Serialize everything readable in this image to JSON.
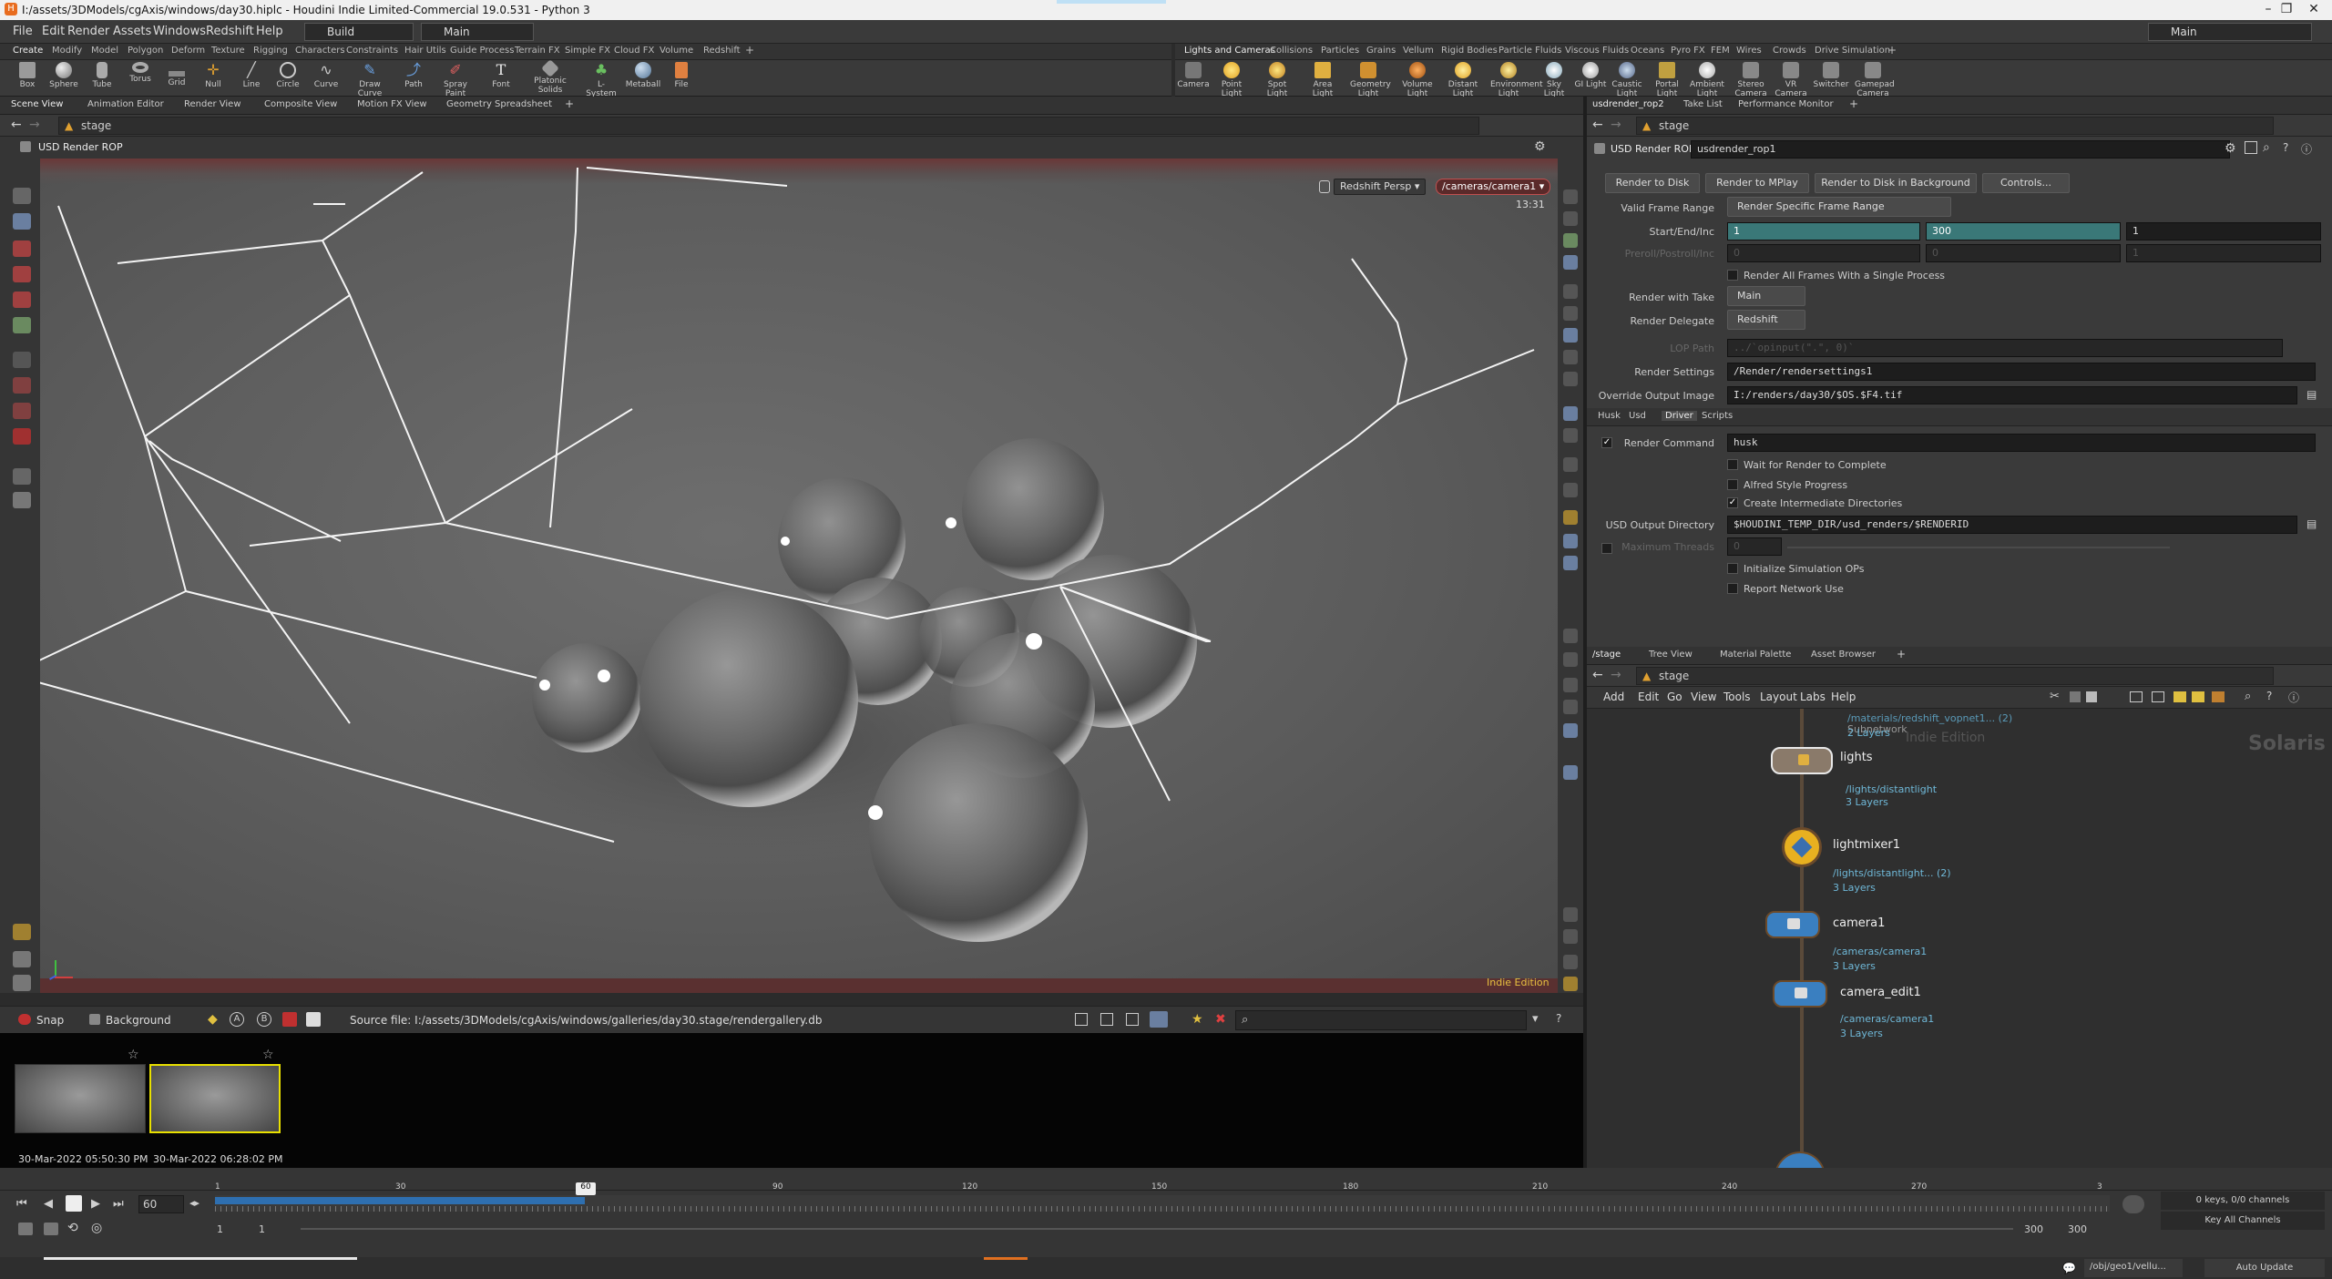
{
  "window": {
    "title": "I:/assets/3DModels/cgAxis/windows/day30.hiplc - Houdini Indie Limited-Commercial 19.0.531 - Python 3",
    "logo": "H",
    "controls": [
      "–",
      "❐",
      "✕"
    ]
  },
  "menu": {
    "items": [
      "File",
      "Edit",
      "Render",
      "Assets",
      "Windows",
      "Redshift",
      "Help"
    ],
    "desktop": "Build",
    "context": "Main",
    "right_context": "Main"
  },
  "shelf_left": {
    "tabs": [
      "Create",
      "Modify",
      "Model",
      "Polygon",
      "Deform",
      "Texture",
      "Rigging",
      "Characters",
      "Constraints",
      "Hair Utils",
      "Guide Process",
      "Terrain FX",
      "Simple FX",
      "Cloud FX",
      "Volume",
      "Redshift",
      "+"
    ],
    "tools": [
      "Box",
      "Sphere",
      "Tube",
      "Torus",
      "Grid",
      "Null",
      "Line",
      "Circle",
      "Curve",
      "Draw Curve",
      "Path",
      "Spray Paint",
      "Font",
      "Platonic Solids",
      "L-System",
      "Metaball",
      "File"
    ]
  },
  "shelf_right": {
    "tabs": [
      "Lights and Cameras",
      "Collisions",
      "Particles",
      "Grains",
      "Vellum",
      "Rigid Bodies",
      "Particle Fluids",
      "Viscous Fluids",
      "Oceans",
      "Pyro FX",
      "FEM",
      "Wires",
      "Crowds",
      "Drive Simulation",
      "+"
    ],
    "tools": [
      "Camera",
      "Point Light",
      "Spot Light",
      "Area Light",
      "Geometry Light",
      "Volume Light",
      "Distant Light",
      "Environment Light",
      "Sky Light",
      "GI Light",
      "Caustic Light",
      "Portal Light",
      "Ambient Light",
      "Stereo Camera",
      "VR Camera",
      "Switcher",
      "Gamepad Camera"
    ]
  },
  "left_pane": {
    "tabs": [
      "Scene View",
      "Animation Editor",
      "Render View",
      "Composite View",
      "Motion FX View",
      "Geometry Spreadsheet",
      "+"
    ],
    "path": "stage",
    "viewer_title": "USD Render ROP",
    "viewport": {
      "renderer": "Redshift  Persp ▾",
      "camera": "/cameras/camera1 ▾",
      "time": "13:31",
      "edition": "Indie Edition"
    }
  },
  "gallery": {
    "snap": "Snap",
    "background": "Background",
    "source": "Source file: I:/assets/3DModels/cgAxis/windows/galleries/day30.stage/rendergallery.db",
    "thumbs": [
      {
        "label": "30-Mar-2022 05:50:30 PM"
      },
      {
        "label": "30-Mar-2022 06:28:02 PM"
      }
    ]
  },
  "timeline": {
    "frame": "60",
    "ticks": [
      "1",
      "30",
      "60",
      "90",
      "120",
      "150",
      "180",
      "210",
      "240",
      "270",
      "3"
    ],
    "start": "1",
    "start2": "1",
    "end": "300",
    "end2": "300",
    "keys": "0 keys, 0/0 channels",
    "key_all": "Key All Channels",
    "auto_update": "Auto Update",
    "path": "/obj/geo1/vellu..."
  },
  "params": {
    "tabs": [
      "usdrender_rop2",
      "Take List",
      "Performance Monitor",
      "+"
    ],
    "path": "stage",
    "node_type": "USD Render ROP",
    "node_name": "usdrender_rop1",
    "buttons": [
      "Render to Disk",
      "Render to MPlay",
      "Render to Disk in Background",
      "Controls..."
    ],
    "valid_frame_range_label": "Valid Frame Range",
    "valid_frame_range": "Render Specific Frame Range",
    "start_end_label": "Start/End/Inc",
    "start": "1",
    "end": "300",
    "inc": "1",
    "preroll_label": "Preroll/Postroll/Inc",
    "preroll": [
      "0",
      "0",
      "1"
    ],
    "single_process": "Render All Frames With a Single Process",
    "take_label": "Render with Take",
    "take": "Main",
    "delegate_label": "Render Delegate",
    "delegate": "Redshift",
    "lop_label": "LOP Path",
    "lop": "../`opinput(\".\", 0)`",
    "settings_label": "Render Settings",
    "settings": "/Render/rendersettings1",
    "output_label": "Override Output Image",
    "output": "I:/renders/day30/$OS.$F4.tif",
    "subtabs": [
      "Husk",
      "Usd",
      "Driver",
      "Scripts"
    ],
    "cmd_label": "Render Command",
    "cmd": "husk",
    "wait": "Wait for Render to Complete",
    "alfred": "Alfred Style Progress",
    "intermediate": "Create Intermediate Directories",
    "usd_dir_label": "USD Output Directory",
    "usd_dir": "$HOUDINI_TEMP_DIR/usd_renders/$RENDERID",
    "threads_label": "Maximum Threads",
    "threads": "0",
    "init_sim": "Initialize Simulation OPs",
    "report": "Report Network Use"
  },
  "network": {
    "tabs": [
      "/stage",
      "Tree View",
      "Material Palette",
      "Asset Browser",
      "+"
    ],
    "path": "stage",
    "menu": [
      "Add",
      "Edit",
      "Go",
      "View",
      "Tools",
      "Layout",
      "Labs",
      "Help"
    ],
    "watermark": "Solaris",
    "edition": "Indie Edition",
    "nodes": [
      {
        "name": "lights",
        "sub": "/lights/distantlight",
        "layers": "3 Layers"
      },
      {
        "name": "lightmixer1",
        "sub": "/lights/distantlight... (2)",
        "layers": "3 Layers"
      },
      {
        "name": "camera1",
        "sub": "/cameras/camera1",
        "layers": "3 Layers"
      },
      {
        "name": "camera_edit1",
        "sub": "/cameras/camera1",
        "layers": "3 Layers"
      }
    ],
    "top_sub": "/materials/redshift_vopnet1... (2)",
    "top_sub2": "Subnetwork",
    "top_layers": "2 Layers"
  }
}
